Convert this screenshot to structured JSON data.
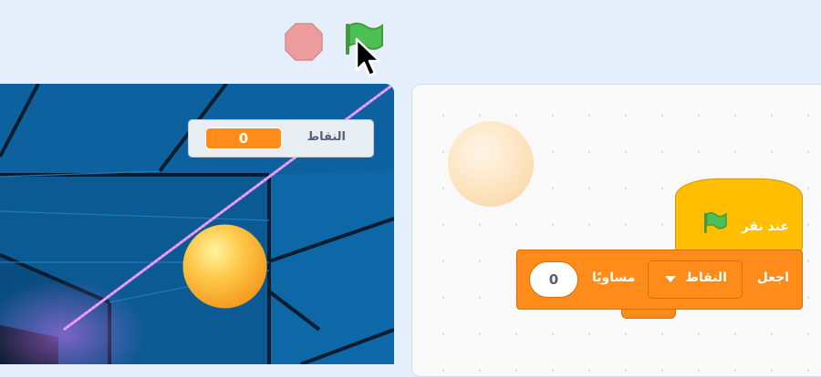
{
  "controls": {
    "flag_icon": "green-flag-icon",
    "stop_icon": "stop-icon"
  },
  "stage": {
    "variable_monitor": {
      "label": "النقاط",
      "value": "0"
    }
  },
  "code_area": {
    "hat_block": {
      "text": "عند نقر"
    },
    "set_block": {
      "label": "اجعل",
      "variable": "النقاط",
      "to_label": "مساويًا",
      "value": "0"
    }
  },
  "colors": {
    "control_bg": "#e5effc",
    "event_block": "#ffbf00",
    "variable_block": "#ff8c1a",
    "flag_green": "#4cbf56",
    "stop_red": "#ec9c9c"
  }
}
